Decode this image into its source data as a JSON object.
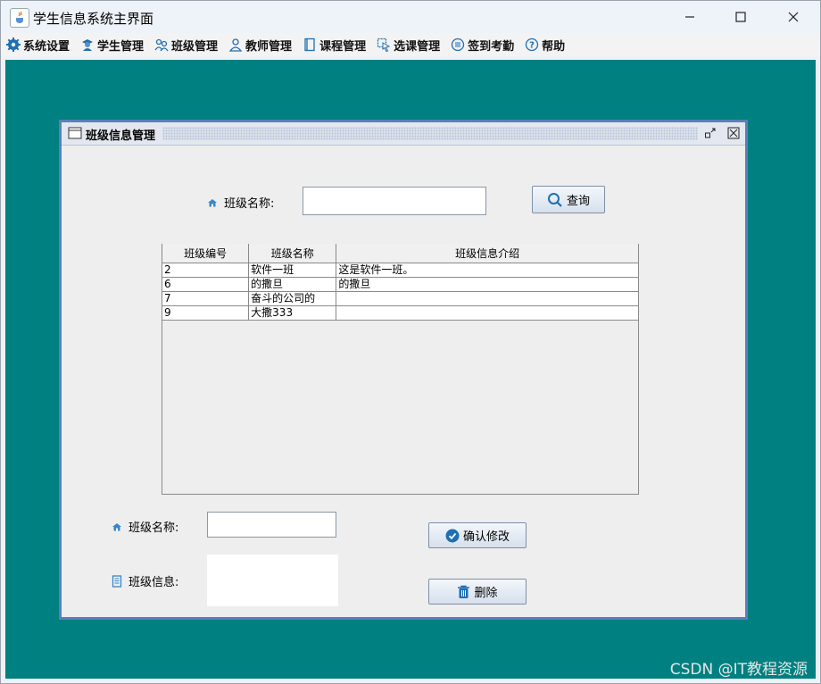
{
  "window": {
    "title": "学生信息系统主界面",
    "menu": [
      {
        "label": "系统设置",
        "icon": "gear-icon"
      },
      {
        "label": "学生管理",
        "icon": "student-icon"
      },
      {
        "label": "班级管理",
        "icon": "class-icon"
      },
      {
        "label": "教师管理",
        "icon": "teacher-icon"
      },
      {
        "label": "课程管理",
        "icon": "course-icon"
      },
      {
        "label": "选课管理",
        "icon": "select-icon"
      },
      {
        "label": "签到考勤",
        "icon": "attendance-icon"
      },
      {
        "label": "帮助",
        "icon": "help-icon"
      }
    ]
  },
  "frame": {
    "title": "班级信息管理",
    "search": {
      "label": "班级名称:",
      "value": "",
      "button": "查询"
    },
    "table": {
      "columns": [
        "班级编号",
        "班级名称",
        "班级信息介绍"
      ],
      "rows": [
        [
          "2",
          "软件一班",
          "这是软件一班。"
        ],
        [
          "6",
          "的撒旦",
          "的撒旦"
        ],
        [
          "7",
          "奋斗的公司的",
          ""
        ],
        [
          "9",
          "大撒333",
          ""
        ]
      ]
    },
    "edit": {
      "name_label": "班级名称:",
      "name_value": "",
      "info_label": "班级信息:",
      "info_value": "",
      "confirm_button": "确认修改",
      "delete_button": "删除"
    }
  },
  "watermark": "CSDN @IT教程资源",
  "colors": {
    "desktop": "#008080",
    "frame_border": "#5b7fbb",
    "accent": "#1f6fb2"
  }
}
